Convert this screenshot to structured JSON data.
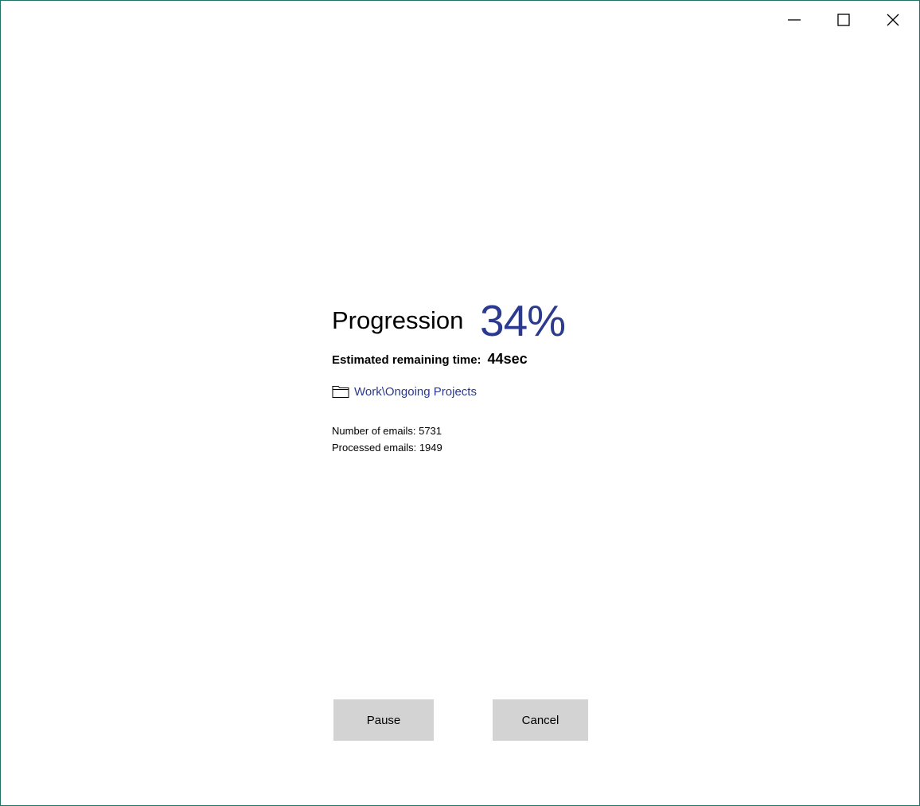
{
  "window": {
    "controls": {
      "minimize_icon": "minimize-icon",
      "maximize_icon": "maximize-icon",
      "close_icon": "close-icon"
    }
  },
  "progress": {
    "title": "Progression",
    "percent_text": "34%",
    "value_percent": 34,
    "eta_label": "Estimated remaining time:",
    "eta_value": "44sec"
  },
  "folder": {
    "icon": "folder-icon",
    "path": "Work\\Ongoing Projects"
  },
  "stats": {
    "total_label": "Number of emails: 5731",
    "processed_label": "Processed emails: 1949"
  },
  "actions": {
    "pause_label": "Pause",
    "cancel_label": "Cancel"
  },
  "colors": {
    "accent": "#2b3a8f",
    "button_bg": "#d3d3d3",
    "window_border": "#1e7466"
  }
}
